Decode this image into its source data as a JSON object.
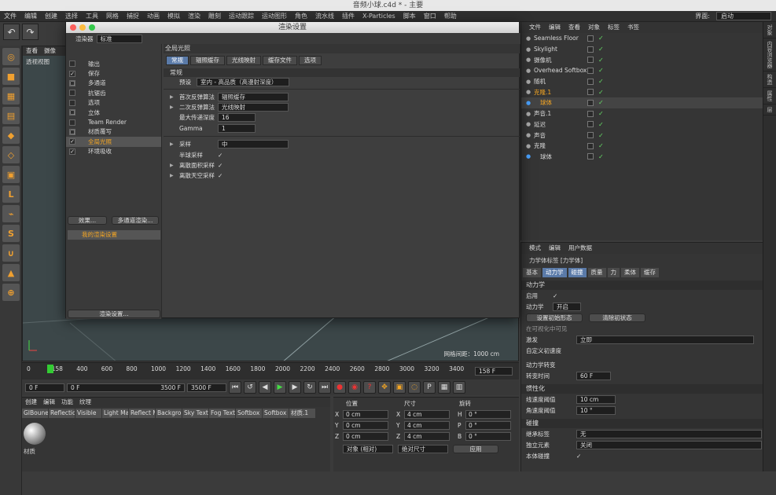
{
  "window_title": "音频小球.c4d * - 主要",
  "menu": [
    "文件",
    "编辑",
    "创建",
    "选择",
    "工具",
    "网格",
    "捕捉",
    "动画",
    "模拟",
    "渲染",
    "雕刻",
    "运动跟踪",
    "运动图形",
    "角色",
    "流水线",
    "插件",
    "X-Particles",
    "脚本",
    "窗口",
    "帮助"
  ],
  "layout_label": "界面:",
  "layout_value": "启动",
  "viewport": {
    "menu": [
      "查看",
      "摄像"
    ],
    "label": "透视视图",
    "grid_info": "网格间距：1000 cm"
  },
  "timeline": {
    "ticks": [
      "0",
      "158",
      "400",
      "600",
      "800",
      "1000",
      "1200",
      "1400",
      "1600",
      "1800",
      "2000",
      "2200",
      "2400",
      "2600",
      "2800",
      "3000",
      "3200",
      "3400"
    ],
    "current_frame": "158 F"
  },
  "transport": {
    "start": "0 F",
    "range_start": "0 F",
    "range_end": "3500 F",
    "end": "3500 F"
  },
  "materials": {
    "menu": [
      "创建",
      "编辑",
      "功能",
      "纹理"
    ],
    "tabs": [
      "GIBoune",
      "Reflectio",
      "Visible",
      "Light Ma",
      "Reflect M",
      "Backgro",
      "Sky Text",
      "Fog Text",
      "Softbox",
      "Softbox",
      "材质.1"
    ],
    "thumb_label": "材质"
  },
  "coords": {
    "headers": [
      "位置",
      "尺寸",
      "旋转"
    ],
    "rows": [
      {
        "a": "X",
        "av": "0 cm",
        "b": "X",
        "bv": "4 cm",
        "c": "H",
        "cv": "0 °"
      },
      {
        "a": "Y",
        "av": "0 cm",
        "b": "Y",
        "bv": "4 cm",
        "c": "P",
        "cv": "0 °"
      },
      {
        "a": "Z",
        "av": "0 cm",
        "b": "Z",
        "bv": "4 cm",
        "c": "B",
        "cv": "0 °"
      }
    ],
    "mode": "对象 (相对)",
    "size_mode": "绝对尺寸",
    "apply": "应用"
  },
  "object_manager": {
    "menu": [
      "文件",
      "编辑",
      "查看",
      "对象",
      "标签",
      "书签"
    ],
    "objects": [
      {
        "name": "Seamless Floor",
        "color": "#d8d8d8"
      },
      {
        "name": "Skylight",
        "color": "#d8d8d8"
      },
      {
        "name": "摄像机",
        "color": "#d8d8d8"
      },
      {
        "name": "Overhead Softbox",
        "color": "#d8d8d8"
      },
      {
        "name": "随机",
        "color": "#d8d8d8"
      },
      {
        "name": "克隆.1",
        "color": "#f5a623"
      },
      {
        "name": "球体",
        "color": "#f5a623"
      },
      {
        "name": "声音.1",
        "color": "#d8d8d8"
      },
      {
        "name": "延迟",
        "color": "#d8d8d8"
      },
      {
        "name": "声音",
        "color": "#d8d8d8"
      },
      {
        "name": "克隆",
        "color": "#d8d8d8"
      },
      {
        "name": "球体",
        "color": "#d8d8d8"
      }
    ]
  },
  "attr_manager": {
    "menu": [
      "模式",
      "编辑",
      "用户数据"
    ],
    "title": "力学体标签 [力学体]",
    "tabs": [
      "基本",
      "动力学",
      "碰撞",
      "质量",
      "力",
      "柔体",
      "缓存"
    ],
    "dyn_section": "动力学",
    "enable_label": "启用",
    "dynamics_label": "动力学",
    "dynamics_value": "开启",
    "set_initial": "设置初始形态",
    "clear_initial": "清除初状态",
    "visible_label": "在可视化中可见",
    "trigger_label": "激发",
    "trigger_value": "立即",
    "custom_vel_label": "自定义初速度",
    "transition_label": "动力学转变",
    "transition_time_label": "转变时间",
    "transition_time_value": "60 F",
    "inertia_section": "惯性化",
    "lin_label": "线速度阈值",
    "lin_value": "10 cm",
    "ang_label": "角速度阈值",
    "ang_value": "10 °",
    "collision_section": "碰撞",
    "inherit_label": "继承标签",
    "inherit_value": "无",
    "independent_label": "独立元素",
    "independent_value": "关闭",
    "self_collide_label": "本体碰撞"
  },
  "right_strip_tabs": [
    "对象",
    "内容浏览器",
    "构造",
    "属性",
    "层"
  ],
  "render_dialog": {
    "title": "渲染设置",
    "renderer_label": "渲染器",
    "renderer_value": "标准",
    "items": [
      {
        "label": "输出",
        "check": ""
      },
      {
        "label": "保存",
        "check": "✓"
      },
      {
        "label": "多通道",
        "check": "□"
      },
      {
        "label": "抗锯齿",
        "check": ""
      },
      {
        "label": "选项",
        "check": ""
      },
      {
        "label": "立体",
        "check": "□"
      },
      {
        "label": "Team Render",
        "check": ""
      },
      {
        "label": "材质覆写",
        "check": "□"
      },
      {
        "label": "全局光照",
        "check": "✓",
        "active": true
      },
      {
        "label": "环境吸收",
        "check": "✓"
      }
    ],
    "effects_button": "效果...",
    "multipass_button": "多通道渲染...",
    "preset_name": "我的渲染设置",
    "settings_button": "渲染设置...",
    "section_title": "全局光照",
    "tabs": [
      "常规",
      "辐照缓存",
      "光线映射",
      "缓存文件",
      "选项"
    ],
    "group_title": "常规",
    "preset_label": "预设",
    "preset_value": "室内 - 高品质（高漫射深度）",
    "primary_label": "首次反弹算法",
    "primary_value": "辐照缓存",
    "secondary_label": "二次反弹算法",
    "secondary_value": "光线映射",
    "depth_label": "最大传递深度",
    "depth_value": "16",
    "gamma_label": "Gamma",
    "gamma_value": "1",
    "sampling_label": "采样",
    "sampling_value": "中",
    "hemi_label": "半球采样",
    "discrete_area_label": "离散面积采样",
    "discrete_sky_label": "离散天空采样"
  }
}
